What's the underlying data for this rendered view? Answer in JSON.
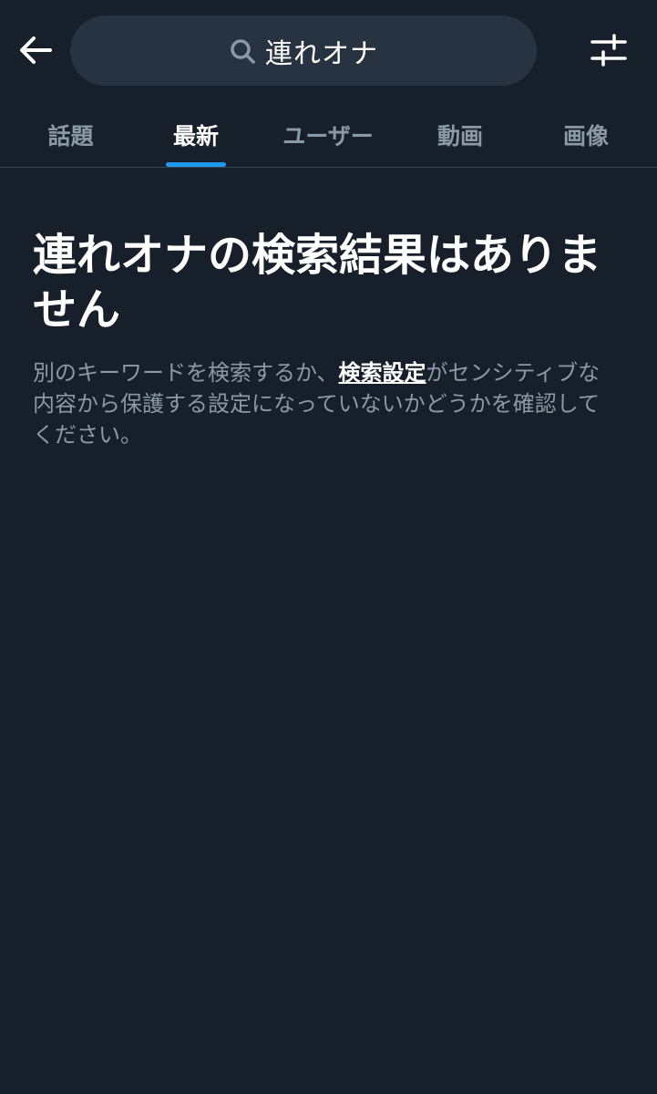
{
  "header": {
    "back_icon": "arrow-left-icon",
    "search_icon": "search-icon",
    "search_query": "連れオナ",
    "filter_icon": "sliders-icon"
  },
  "tabs": [
    {
      "label": "話題",
      "active": false
    },
    {
      "label": "最新",
      "active": true
    },
    {
      "label": "ユーザー",
      "active": false
    },
    {
      "label": "動画",
      "active": false
    },
    {
      "label": "画像",
      "active": false
    }
  ],
  "empty_state": {
    "title": "連れオナの検索結果はありません",
    "desc_before": "別のキーワードを検索するか、",
    "settings_link": "検索設定",
    "desc_after": "がセンシティブな内容から保護する設定になっていないかどうかを確認してください。"
  },
  "colors": {
    "background": "#17202a",
    "search_box": "#273340",
    "accent": "#1d9bf0",
    "secondary_text": "#8b98a5"
  }
}
